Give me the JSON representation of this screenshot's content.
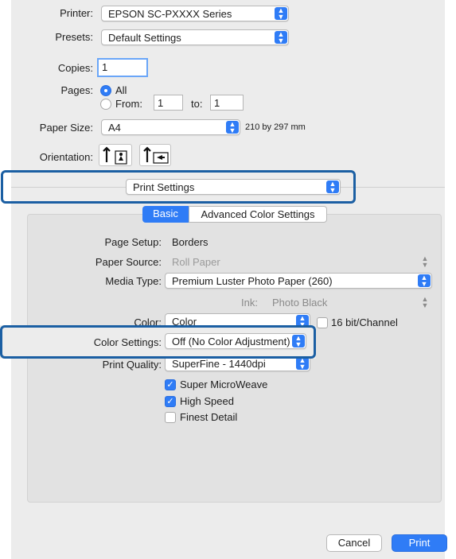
{
  "printer": {
    "label": "Printer:",
    "value": "EPSON SC-PXXXX Series"
  },
  "presets": {
    "label": "Presets:",
    "value": "Default Settings"
  },
  "copies": {
    "label": "Copies:",
    "value": "1"
  },
  "pages": {
    "label": "Pages:",
    "all": "All",
    "from_label": "From:",
    "from": "1",
    "to_label": "to:",
    "to": "1"
  },
  "paper_size": {
    "label": "Paper Size:",
    "value": "A4",
    "dimensions": "210 by 297 mm"
  },
  "orientation": {
    "label": "Orientation:"
  },
  "section_popup": {
    "value": "Print Settings"
  },
  "tabs": [
    {
      "label": "Basic",
      "selected": true
    },
    {
      "label": "Advanced Color Settings",
      "selected": false
    }
  ],
  "settings": {
    "page_setup": {
      "label": "Page Setup:",
      "value": "Borders"
    },
    "paper_source": {
      "label": "Paper Source:",
      "value": "Roll Paper"
    },
    "media_type": {
      "label": "Media Type:",
      "value": "Premium Luster Photo Paper (260)"
    },
    "ink": {
      "label": "Ink:",
      "value": "Photo Black"
    },
    "color": {
      "label": "Color:",
      "value": "Color",
      "bit_label": "16 bit/Channel"
    },
    "color_settings": {
      "label": "Color Settings:",
      "value": "Off (No Color Adjustment)"
    },
    "print_quality": {
      "label": "Print Quality:",
      "value": "SuperFine - 1440dpi"
    }
  },
  "checkboxes": [
    {
      "label": "Super MicroWeave",
      "checked": true
    },
    {
      "label": "High Speed",
      "checked": true
    },
    {
      "label": "Finest Detail",
      "checked": false
    }
  ],
  "buttons": {
    "cancel": "Cancel",
    "print": "Print"
  },
  "colors": {
    "accent": "#2f7cf6",
    "highlight": "#1b5fa3"
  }
}
